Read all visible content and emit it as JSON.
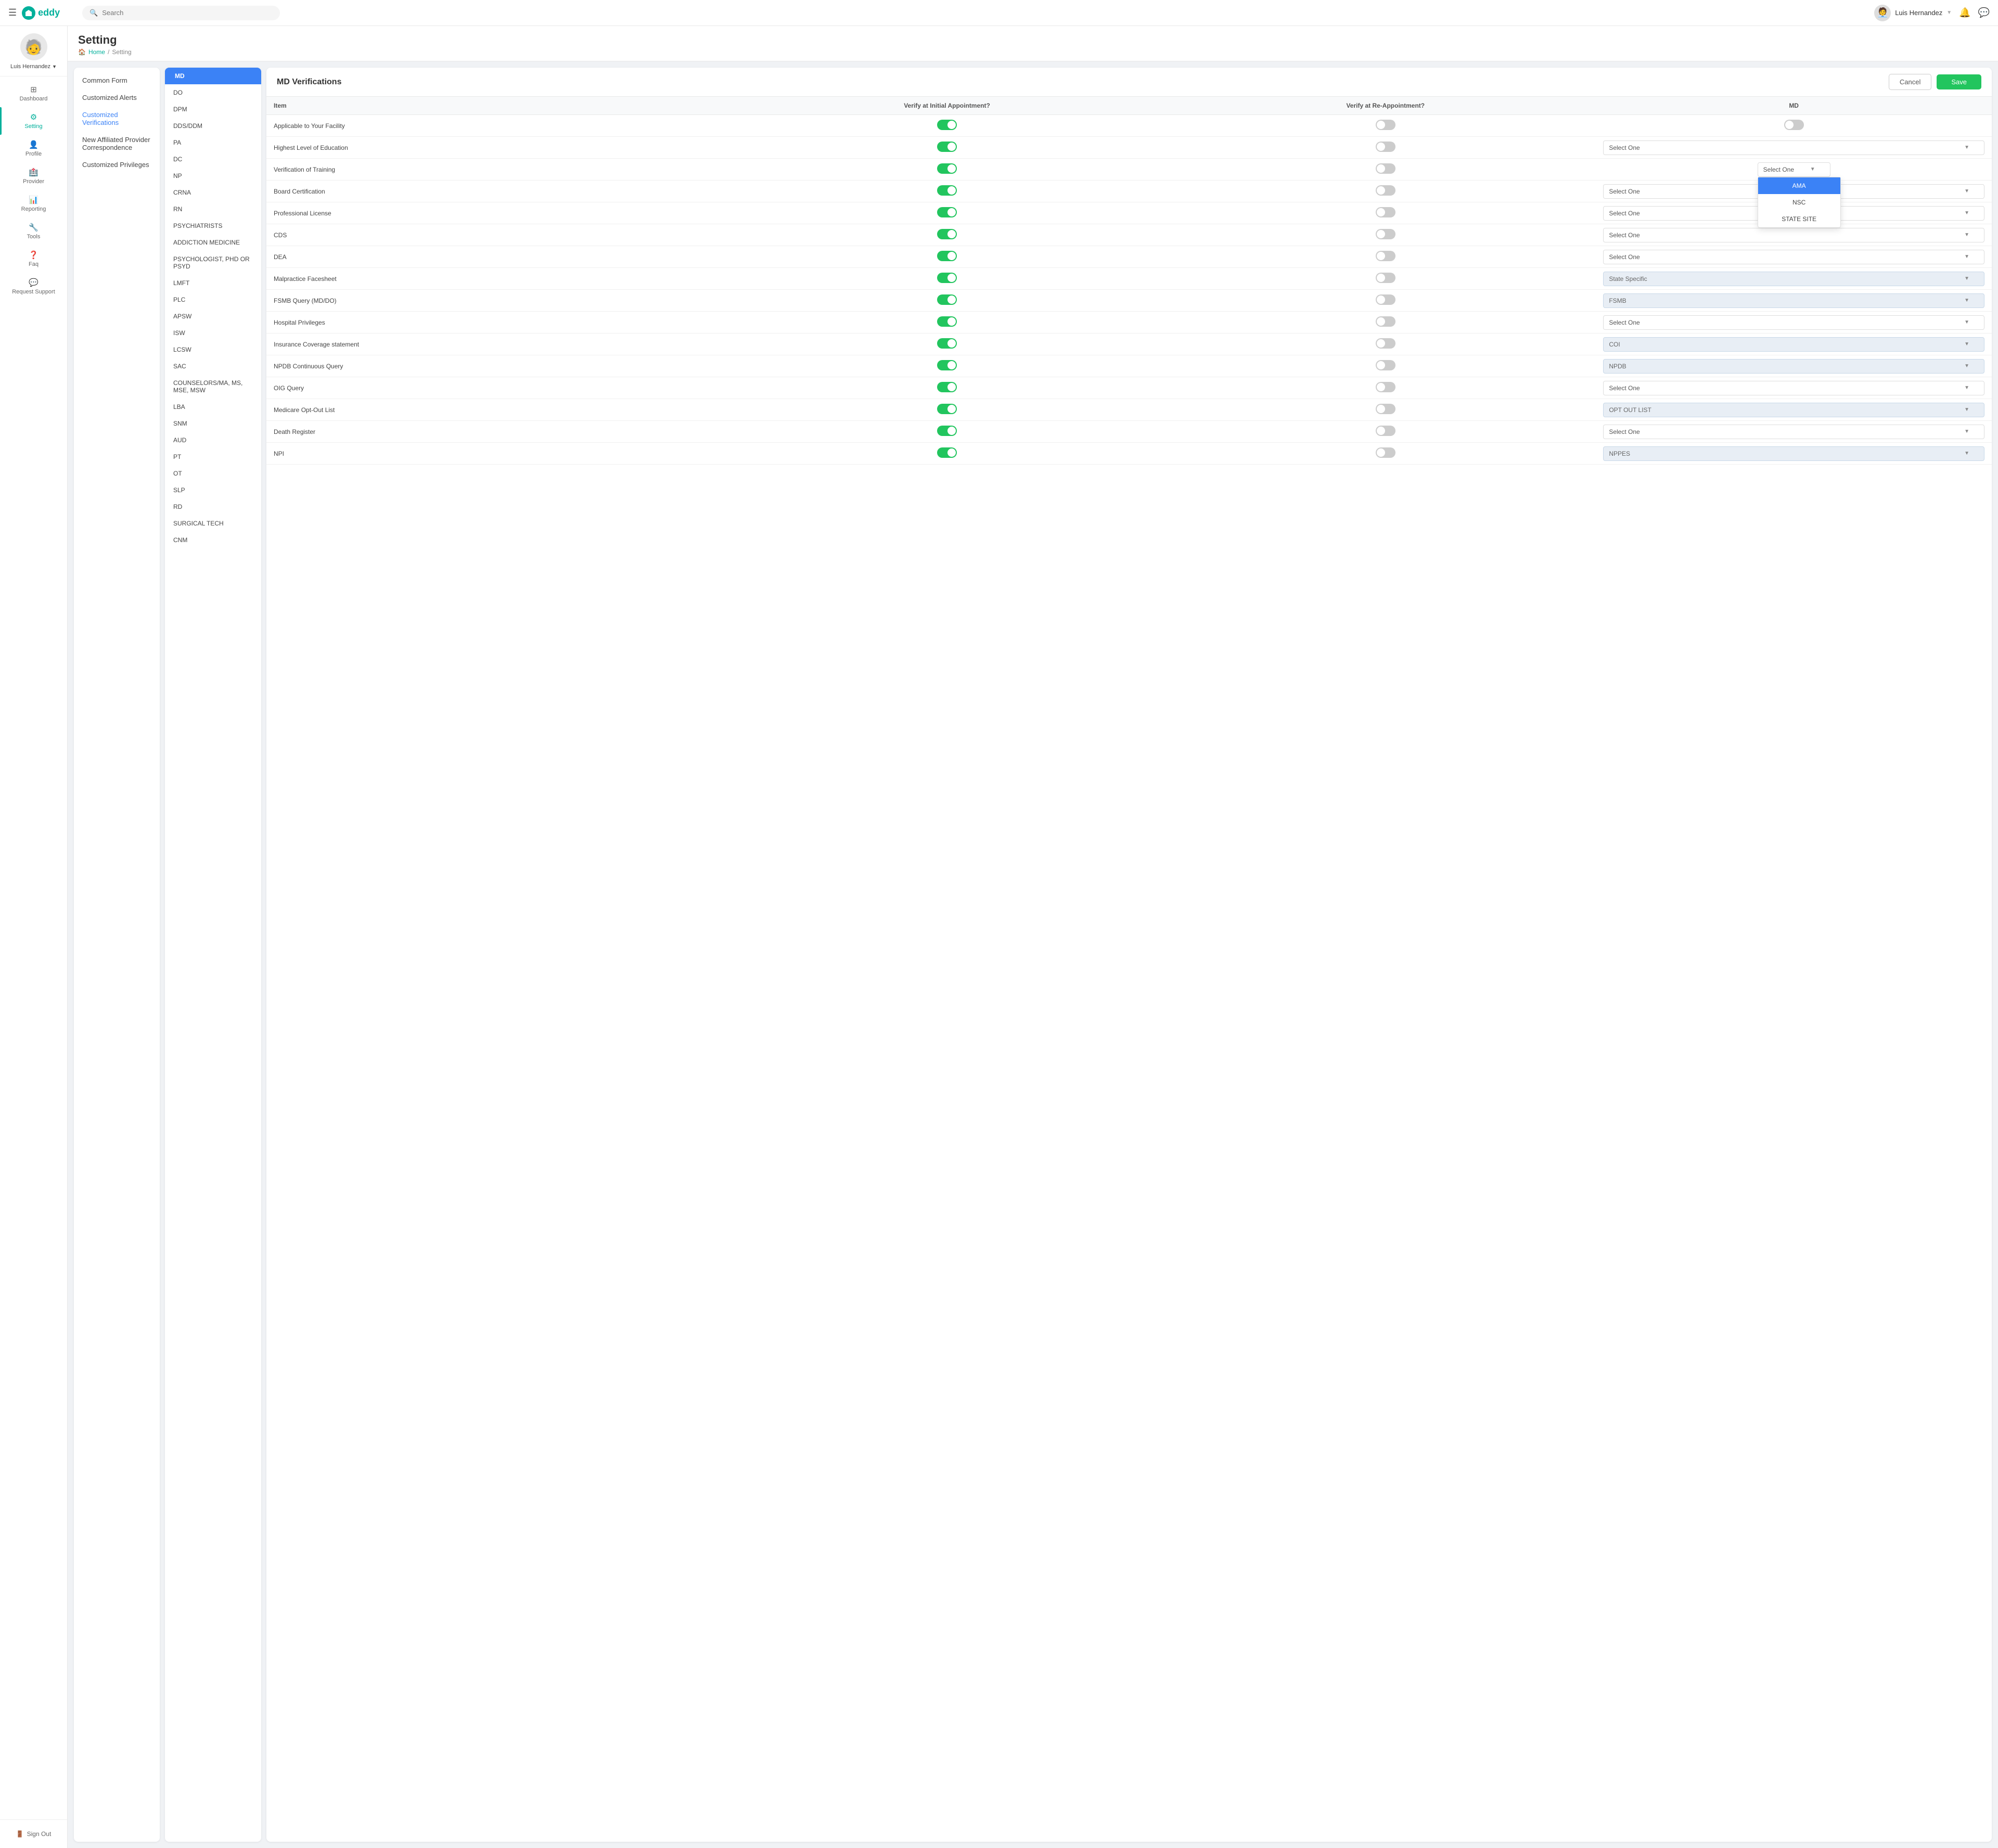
{
  "topbar": {
    "hamburger": "☰",
    "logo_text": "eddy",
    "search_placeholder": "Search",
    "user_name": "Luis Hernandez",
    "user_avatar_emoji": "🧑‍💼"
  },
  "sidebar": {
    "user_avatar_emoji": "🧓",
    "user_name": "Luis Hernandez",
    "nav_items": [
      {
        "id": "dashboard",
        "label": "Dashboard",
        "icon": "⊞"
      },
      {
        "id": "setting",
        "label": "Setting",
        "icon": "⚙"
      },
      {
        "id": "profile",
        "label": "Profile",
        "icon": "👤"
      },
      {
        "id": "provider",
        "label": "Provider",
        "icon": "🏥"
      },
      {
        "id": "reporting",
        "label": "Reporting",
        "icon": "📊"
      },
      {
        "id": "tools",
        "label": "Tools",
        "icon": "🔧"
      },
      {
        "id": "faq",
        "label": "Faq",
        "icon": "❓"
      },
      {
        "id": "request-support",
        "label": "Request Support",
        "icon": "💬"
      }
    ],
    "signout_label": "Sign Out"
  },
  "page": {
    "title": "Setting",
    "breadcrumb_home": "Home",
    "breadcrumb_separator": "/",
    "breadcrumb_current": "Setting"
  },
  "sub_nav": {
    "items": [
      {
        "id": "common-form",
        "label": "Common Form"
      },
      {
        "id": "customized-alerts",
        "label": "Customized Alerts"
      },
      {
        "id": "customized-verifications",
        "label": "Customized Verifications",
        "active": true
      },
      {
        "id": "new-affiliated",
        "label": "New Affiliated Provider Correspondence"
      },
      {
        "id": "customized-privileges",
        "label": "Customized Privileges"
      }
    ]
  },
  "type_nav": {
    "items": [
      {
        "id": "md",
        "label": "MD",
        "active": true
      },
      {
        "id": "do",
        "label": "DO"
      },
      {
        "id": "dpm",
        "label": "DPM"
      },
      {
        "id": "dds-ddm",
        "label": "DDS/DDM"
      },
      {
        "id": "pa",
        "label": "PA"
      },
      {
        "id": "dc",
        "label": "DC"
      },
      {
        "id": "np",
        "label": "NP"
      },
      {
        "id": "crna",
        "label": "CRNA"
      },
      {
        "id": "rn",
        "label": "RN"
      },
      {
        "id": "psychiatrists",
        "label": "PSYCHIATRISTS"
      },
      {
        "id": "addiction-medicine",
        "label": "ADDICTION MEDICINE"
      },
      {
        "id": "psychologist",
        "label": "PSYCHOLOGIST, PHD OR PSYD"
      },
      {
        "id": "lmft",
        "label": "LMFT"
      },
      {
        "id": "plc",
        "label": "PLC"
      },
      {
        "id": "apsw",
        "label": "APSW"
      },
      {
        "id": "isw",
        "label": "ISW"
      },
      {
        "id": "lcsw",
        "label": "LCSW"
      },
      {
        "id": "sac",
        "label": "SAC"
      },
      {
        "id": "counselors",
        "label": "COUNSELORS/MA, MS, MSE, MSW"
      },
      {
        "id": "lba",
        "label": "LBA"
      },
      {
        "id": "snm",
        "label": "SNM"
      },
      {
        "id": "aud",
        "label": "AUD"
      },
      {
        "id": "pt",
        "label": "PT"
      },
      {
        "id": "ot",
        "label": "OT"
      },
      {
        "id": "slp",
        "label": "SLP"
      },
      {
        "id": "rd",
        "label": "RD"
      },
      {
        "id": "surgical-tech",
        "label": "SURGICAL TECH"
      },
      {
        "id": "cnm",
        "label": "CNM"
      }
    ]
  },
  "panel": {
    "title": "MD Verifications",
    "cancel_label": "Cancel",
    "save_label": "Save"
  },
  "table": {
    "headers": [
      "Item",
      "Verify at Initial Appointment?",
      "Verify at Re-Appointment?",
      "MD"
    ],
    "rows": [
      {
        "item": "Applicable to Your Facility",
        "initial": true,
        "reappointment": false,
        "md_value": "",
        "md_type": "toggle"
      },
      {
        "item": "Highest Level of Education",
        "initial": true,
        "reappointment": false,
        "md_value": "Select One",
        "md_type": "select"
      },
      {
        "item": "Verification of Training",
        "initial": true,
        "reappointment": false,
        "md_value": "Select One",
        "md_type": "select-dropdown-open"
      },
      {
        "item": "Board Certification",
        "initial": true,
        "reappointment": false,
        "md_value": "Select One",
        "md_type": "select"
      },
      {
        "item": "Professional License",
        "initial": true,
        "reappointment": false,
        "md_value": "Select One",
        "md_type": "select"
      },
      {
        "item": "CDS",
        "initial": true,
        "reappointment": false,
        "md_value": "Select One",
        "md_type": "select"
      },
      {
        "item": "DEA",
        "initial": true,
        "reappointment": false,
        "md_value": "Select One",
        "md_type": "select"
      },
      {
        "item": "Malpractice Facesheet",
        "initial": true,
        "reappointment": false,
        "md_value": "State Specific",
        "md_type": "select-disabled"
      },
      {
        "item": "FSMB Query (MD/DO)",
        "initial": true,
        "reappointment": false,
        "md_value": "FSMB",
        "md_type": "select-disabled"
      },
      {
        "item": "Hospital Privileges",
        "initial": true,
        "reappointment": false,
        "md_value": "Select One",
        "md_type": "select"
      },
      {
        "item": "Insurance Coverage statement",
        "initial": true,
        "reappointment": false,
        "md_value": "COI",
        "md_type": "select-disabled"
      },
      {
        "item": "NPDB Continuous Query",
        "initial": true,
        "reappointment": false,
        "md_value": "NPDB",
        "md_type": "select-disabled"
      },
      {
        "item": "OIG Query",
        "initial": true,
        "reappointment": false,
        "md_value": "Select One",
        "md_type": "select"
      },
      {
        "item": "Medicare Opt-Out List",
        "initial": true,
        "reappointment": false,
        "md_value": "OPT OUT LIST",
        "md_type": "select-disabled"
      },
      {
        "item": "Death Register",
        "initial": true,
        "reappointment": false,
        "md_value": "Select One",
        "md_type": "select"
      },
      {
        "item": "NPI",
        "initial": true,
        "reappointment": false,
        "md_value": "NPPES",
        "md_type": "select-disabled"
      }
    ],
    "dropdown_options": [
      {
        "label": "AMA",
        "active": true
      },
      {
        "label": "NSC",
        "active": false
      },
      {
        "label": "STATE SITE",
        "active": false
      }
    ],
    "open_dropdown_row": 2
  }
}
